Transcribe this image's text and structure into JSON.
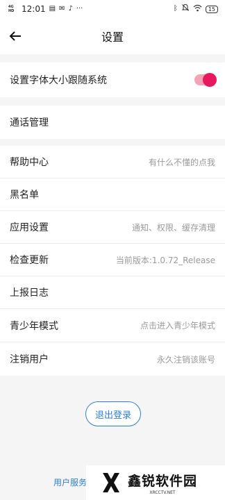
{
  "status_bar": {
    "network": "4G HD",
    "time": "12:01",
    "icons": [
      "message-icon",
      "mail-icon",
      "tiktok-icon",
      "more-icon"
    ],
    "right_icons": [
      "bluetooth-icon",
      "mute-icon",
      "wifi-icon"
    ],
    "battery": "15"
  },
  "header": {
    "title": "设置"
  },
  "settings": {
    "font_follow": {
      "label": "设置字体大小跟随系统",
      "enabled": true
    },
    "call_mgmt": {
      "label": "通话管理"
    },
    "help": {
      "label": "帮助中心",
      "hint": "有什么不懂的点我"
    },
    "blacklist": {
      "label": "黑名单"
    },
    "app_settings": {
      "label": "应用设置",
      "hint": "通知、权限、缓存清理"
    },
    "update": {
      "label": "检查更新",
      "hint": "当前版本:1.0.72_Release"
    },
    "report_log": {
      "label": "上报日志"
    },
    "youth_mode": {
      "label": "青少年模式",
      "hint": "点击进入青少年模式"
    },
    "delete_account": {
      "label": "注销用户",
      "hint": "永久注销该账号"
    }
  },
  "logout_label": "退出登录",
  "footer_link": "用户服务",
  "watermark": {
    "main": "鑫锐软件园",
    "sub": "XRCCTV.NET"
  },
  "colors": {
    "accent": "#2b7fd8",
    "toggle": "#e8185f"
  }
}
